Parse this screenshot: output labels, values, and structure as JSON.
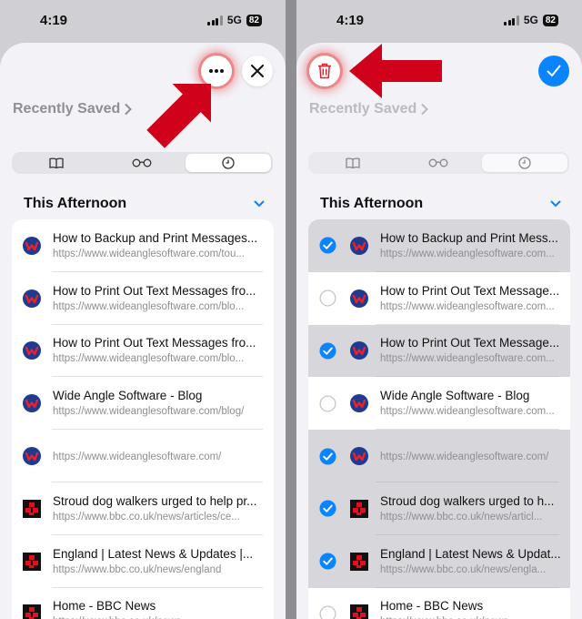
{
  "left": {
    "status": {
      "time": "4:19",
      "network": "5G",
      "battery": "82"
    },
    "recently_saved": "Recently Saved",
    "section_title": "This Afternoon",
    "items": [
      {
        "title": "How to Backup and Print Messages...",
        "url": "https://www.wideanglesoftware.com/tou...",
        "icon": "wideangle-favicon"
      },
      {
        "title": "How to Print Out Text Messages fro...",
        "url": "https://www.wideanglesoftware.com/blo...",
        "icon": "wideangle-favicon"
      },
      {
        "title": "How to Print Out Text Messages fro...",
        "url": "https://www.wideanglesoftware.com/blo...",
        "icon": "wideangle-favicon"
      },
      {
        "title": "Wide Angle Software - Blog",
        "url": "https://www.wideanglesoftware.com/blog/",
        "icon": "wideangle-favicon"
      },
      {
        "title": "",
        "url": "https://www.wideanglesoftware.com/",
        "icon": "wideangle-favicon"
      },
      {
        "title": "Stroud dog walkers urged to help pr...",
        "url": "https://www.bbc.co.uk/news/articles/ce...",
        "icon": "bbc-favicon"
      },
      {
        "title": "England | Latest News & Updates |...",
        "url": "https://www.bbc.co.uk/news/england",
        "icon": "bbc-favicon"
      },
      {
        "title": "Home - BBC News",
        "url": "https://www.bbc.co.uk/news",
        "icon": "bbc-favicon"
      }
    ]
  },
  "right": {
    "status": {
      "time": "4:19",
      "network": "5G",
      "battery": "82"
    },
    "recently_saved": "Recently Saved",
    "section_title": "This Afternoon",
    "items": [
      {
        "title": "How to Backup and Print Mess...",
        "url": "https://www.wideanglesoftware.com...",
        "selected": true
      },
      {
        "title": "How to Print Out Text Message...",
        "url": "https://www.wideanglesoftware.com...",
        "selected": false
      },
      {
        "title": "How to Print Out Text Message...",
        "url": "https://www.wideanglesoftware.com...",
        "selected": true
      },
      {
        "title": "Wide Angle Software - Blog",
        "url": "https://www.wideanglesoftware.com...",
        "selected": false
      },
      {
        "title": "",
        "url": "https://www.wideanglesoftware.com/",
        "selected": true
      },
      {
        "title": "Stroud dog walkers urged to h...",
        "url": "https://www.bbc.co.uk/news/articl...",
        "selected": true
      },
      {
        "title": "England | Latest News & Updat...",
        "url": "https://www.bbc.co.uk/news/engla...",
        "selected": true
      },
      {
        "title": "Home - BBC News",
        "url": "https://www.bbc.co.uk/news",
        "selected": false
      }
    ]
  },
  "colors": {
    "accent": "#0a84ff",
    "annotation_arrow": "#d0021b",
    "selected_row": "#d6d6db",
    "sheet_bg": "#f2f2f7"
  }
}
